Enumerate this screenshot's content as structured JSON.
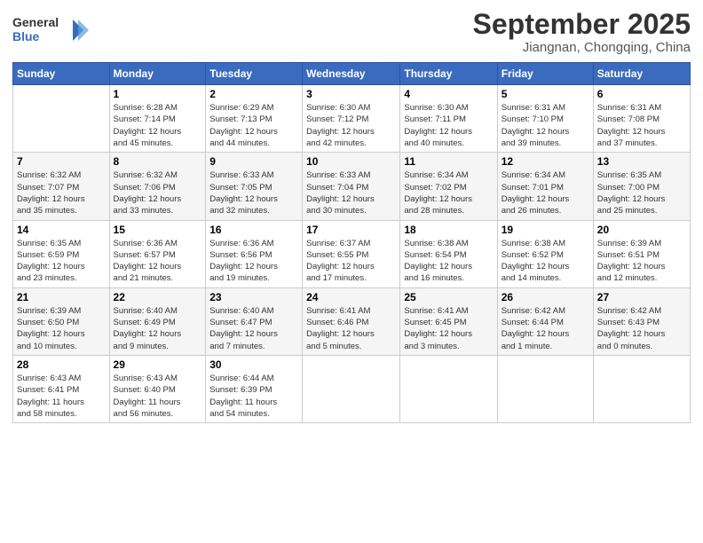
{
  "app": {
    "name": "GeneralBlue",
    "logo_lines": [
      "General",
      "Blue"
    ]
  },
  "header": {
    "month_year": "September 2025",
    "location": "Jiangnan, Chongqing, China"
  },
  "calendar": {
    "days_of_week": [
      "Sunday",
      "Monday",
      "Tuesday",
      "Wednesday",
      "Thursday",
      "Friday",
      "Saturday"
    ],
    "weeks": [
      [
        {
          "day": "",
          "info": ""
        },
        {
          "day": "1",
          "info": "Sunrise: 6:28 AM\nSunset: 7:14 PM\nDaylight: 12 hours\nand 45 minutes."
        },
        {
          "day": "2",
          "info": "Sunrise: 6:29 AM\nSunset: 7:13 PM\nDaylight: 12 hours\nand 44 minutes."
        },
        {
          "day": "3",
          "info": "Sunrise: 6:30 AM\nSunset: 7:12 PM\nDaylight: 12 hours\nand 42 minutes."
        },
        {
          "day": "4",
          "info": "Sunrise: 6:30 AM\nSunset: 7:11 PM\nDaylight: 12 hours\nand 40 minutes."
        },
        {
          "day": "5",
          "info": "Sunrise: 6:31 AM\nSunset: 7:10 PM\nDaylight: 12 hours\nand 39 minutes."
        },
        {
          "day": "6",
          "info": "Sunrise: 6:31 AM\nSunset: 7:08 PM\nDaylight: 12 hours\nand 37 minutes."
        }
      ],
      [
        {
          "day": "7",
          "info": "Sunrise: 6:32 AM\nSunset: 7:07 PM\nDaylight: 12 hours\nand 35 minutes."
        },
        {
          "day": "8",
          "info": "Sunrise: 6:32 AM\nSunset: 7:06 PM\nDaylight: 12 hours\nand 33 minutes."
        },
        {
          "day": "9",
          "info": "Sunrise: 6:33 AM\nSunset: 7:05 PM\nDaylight: 12 hours\nand 32 minutes."
        },
        {
          "day": "10",
          "info": "Sunrise: 6:33 AM\nSunset: 7:04 PM\nDaylight: 12 hours\nand 30 minutes."
        },
        {
          "day": "11",
          "info": "Sunrise: 6:34 AM\nSunset: 7:02 PM\nDaylight: 12 hours\nand 28 minutes."
        },
        {
          "day": "12",
          "info": "Sunrise: 6:34 AM\nSunset: 7:01 PM\nDaylight: 12 hours\nand 26 minutes."
        },
        {
          "day": "13",
          "info": "Sunrise: 6:35 AM\nSunset: 7:00 PM\nDaylight: 12 hours\nand 25 minutes."
        }
      ],
      [
        {
          "day": "14",
          "info": "Sunrise: 6:35 AM\nSunset: 6:59 PM\nDaylight: 12 hours\nand 23 minutes."
        },
        {
          "day": "15",
          "info": "Sunrise: 6:36 AM\nSunset: 6:57 PM\nDaylight: 12 hours\nand 21 minutes."
        },
        {
          "day": "16",
          "info": "Sunrise: 6:36 AM\nSunset: 6:56 PM\nDaylight: 12 hours\nand 19 minutes."
        },
        {
          "day": "17",
          "info": "Sunrise: 6:37 AM\nSunset: 6:55 PM\nDaylight: 12 hours\nand 17 minutes."
        },
        {
          "day": "18",
          "info": "Sunrise: 6:38 AM\nSunset: 6:54 PM\nDaylight: 12 hours\nand 16 minutes."
        },
        {
          "day": "19",
          "info": "Sunrise: 6:38 AM\nSunset: 6:52 PM\nDaylight: 12 hours\nand 14 minutes."
        },
        {
          "day": "20",
          "info": "Sunrise: 6:39 AM\nSunset: 6:51 PM\nDaylight: 12 hours\nand 12 minutes."
        }
      ],
      [
        {
          "day": "21",
          "info": "Sunrise: 6:39 AM\nSunset: 6:50 PM\nDaylight: 12 hours\nand 10 minutes."
        },
        {
          "day": "22",
          "info": "Sunrise: 6:40 AM\nSunset: 6:49 PM\nDaylight: 12 hours\nand 9 minutes."
        },
        {
          "day": "23",
          "info": "Sunrise: 6:40 AM\nSunset: 6:47 PM\nDaylight: 12 hours\nand 7 minutes."
        },
        {
          "day": "24",
          "info": "Sunrise: 6:41 AM\nSunset: 6:46 PM\nDaylight: 12 hours\nand 5 minutes."
        },
        {
          "day": "25",
          "info": "Sunrise: 6:41 AM\nSunset: 6:45 PM\nDaylight: 12 hours\nand 3 minutes."
        },
        {
          "day": "26",
          "info": "Sunrise: 6:42 AM\nSunset: 6:44 PM\nDaylight: 12 hours\nand 1 minute."
        },
        {
          "day": "27",
          "info": "Sunrise: 6:42 AM\nSunset: 6:43 PM\nDaylight: 12 hours\nand 0 minutes."
        }
      ],
      [
        {
          "day": "28",
          "info": "Sunrise: 6:43 AM\nSunset: 6:41 PM\nDaylight: 11 hours\nand 58 minutes."
        },
        {
          "day": "29",
          "info": "Sunrise: 6:43 AM\nSunset: 6:40 PM\nDaylight: 11 hours\nand 56 minutes."
        },
        {
          "day": "30",
          "info": "Sunrise: 6:44 AM\nSunset: 6:39 PM\nDaylight: 11 hours\nand 54 minutes."
        },
        {
          "day": "",
          "info": ""
        },
        {
          "day": "",
          "info": ""
        },
        {
          "day": "",
          "info": ""
        },
        {
          "day": "",
          "info": ""
        }
      ]
    ]
  }
}
